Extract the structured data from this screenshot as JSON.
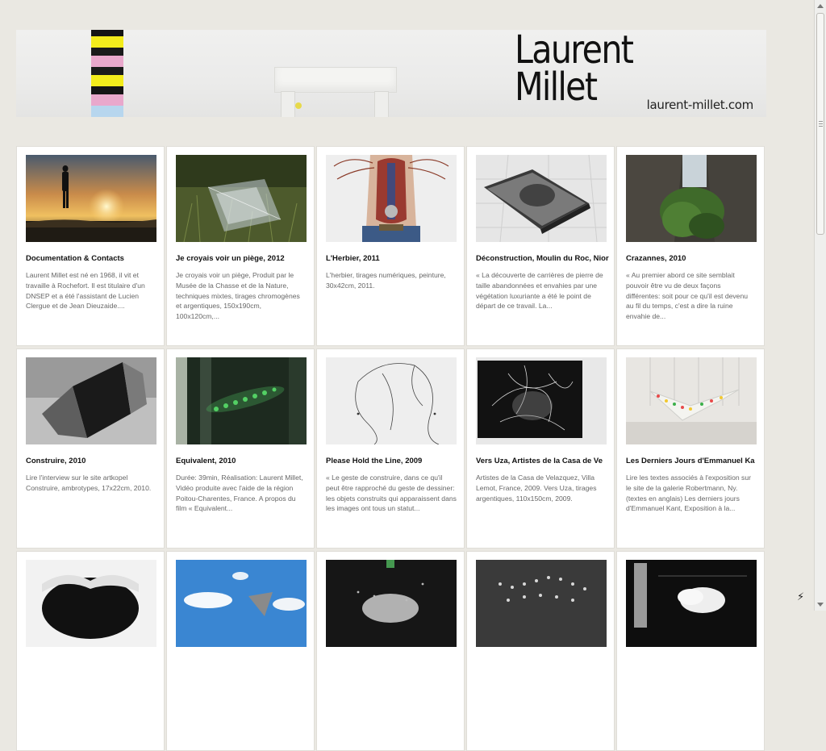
{
  "header": {
    "logo_line1": "Laurent",
    "logo_line2": "Millet",
    "site_url": "laurent-millet.com"
  },
  "cards": [
    {
      "title": "Documentation & Contacts",
      "description": "Laurent Millet est né en 1968, il vit et travaille à Rochefort. Il est titulaire d'un DNSEP et a été l'assistant de Lucien Clergue et de Jean Dieuzaide...."
    },
    {
      "title": "Je croyais voir un piège, 2012",
      "description": "Je croyais voir un piège, Produit par le Musée de la Chasse et de la Nature, techniques mixtes, tirages chromogènes et argentiques, 150x190cm, 100x120cm,..."
    },
    {
      "title": "L'Herbier, 2011",
      "description": "L'herbier, tirages numériques, peinture, 30x42cm, 2011."
    },
    {
      "title": "Déconstruction, Moulin du Roc, Nior",
      "description": "« La découverte de carrières de pierre de taille abandonnées et envahies par une végétation luxuriante a été le point de départ de ce travail. La..."
    },
    {
      "title": "Crazannes, 2010",
      "description": "« Au premier abord ce site semblait pouvoir être vu de deux façons différentes: soit pour ce qu'il est devenu au fil du temps, c'est a dire la ruine envahie de..."
    },
    {
      "title": "Construire, 2010",
      "description": "Lire l'interview  sur le site artkopel Construire, ambrotypes, 17x22cm, 2010."
    },
    {
      "title": "Equivalent, 2010",
      "description": "Durée: 39min, Réalisation: Laurent Millet, Vidéo produite avec l'aide de la région Poitou-Charentes, France. A propos du film « Equivalent..."
    },
    {
      "title": "Please Hold the Line, 2009",
      "description": "« Le geste de construire, dans ce qu'il peut être rapproché du geste de dessiner: les objets construits qui apparaissent dans les images ont tous un statut..."
    },
    {
      "title": "Vers Uza, Artistes de la Casa de Ve",
      "description": "Artistes de la Casa de Velazquez, Villa Lemot, France, 2009. Vers Uza, tirages argentiques, 110x150cm, 2009."
    },
    {
      "title": "Les Derniers Jours d'Emmanuel Ka",
      "description": "Lire les textes associés à l'exposition sur le site de la galerie Robertmann, Ny. (textes en anglais) Les derniers jours d'Emmanuel Kant, Exposition à la..."
    },
    {
      "title": "",
      "description": ""
    },
    {
      "title": "",
      "description": ""
    },
    {
      "title": "",
      "description": ""
    },
    {
      "title": "",
      "description": ""
    },
    {
      "title": "",
      "description": ""
    }
  ],
  "thumbnail_icons": [
    "sunset-figure-photo",
    "grass-structure-photo",
    "anatomy-torso-photo",
    "book-on-floor-photo",
    "quarry-ruin-photo",
    "geometric-shadow-photo",
    "green-light-photo",
    "line-drawing-photo",
    "black-sculpture-photo",
    "light-installation-photo",
    "white-foam-photo",
    "sky-clouds-photo",
    "splash-dark-photo",
    "dots-chalkboard-photo",
    "cloud-box-photo"
  ],
  "colors": {
    "page_background": "#eae8e2",
    "card_background": "#ffffff",
    "title_text": "#111111",
    "description_text": "#666666"
  }
}
